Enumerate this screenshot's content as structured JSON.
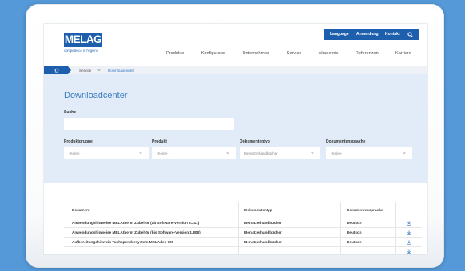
{
  "colors": {
    "background": "#5699d8",
    "brand_blue": "#1e5fad",
    "link_blue": "#3b7cc2",
    "panel_blue": "#e1ecf8"
  },
  "icons": {
    "search": "search-icon",
    "home": "home-icon",
    "breadcrumb_separator": "chevron-down-icon",
    "select_arrow": "chevron-down-icon",
    "download": "download-icon"
  },
  "utility_nav": {
    "items": [
      "Language",
      "Anmeldung",
      "Kontakt"
    ]
  },
  "logo": {
    "wordmark": "MELAG",
    "tagline": "competence in hygiene"
  },
  "main_nav": {
    "items": [
      "Produkte",
      "Konfigurator",
      "Unternehmen",
      "Service",
      "Akademie",
      "Referenzen",
      "Karriere"
    ]
  },
  "breadcrumb": {
    "items": [
      "Service",
      "Downloadcenter"
    ]
  },
  "page": {
    "title": "Downloadcenter"
  },
  "search": {
    "label": "Suche",
    "value": ""
  },
  "filters": [
    {
      "label": "Produktgruppe",
      "selected": "-Keine-"
    },
    {
      "label": "Produkt",
      "selected": "-Keine-"
    },
    {
      "label": "Dokumententyp",
      "selected": "Benutzerhandbücher"
    },
    {
      "label": "Dokumentensprache",
      "selected": "-Keine-"
    }
  ],
  "table": {
    "columns": [
      "Dokument",
      "Dokumententyp",
      "Dokumentensprache"
    ],
    "rows": [
      {
        "document": "Anwendungshinweise MELAtherm Zubehör (ab Software-Version 3.311)",
        "type": "Benutzerhandbücher",
        "language": "Deutsch"
      },
      {
        "document": "Anwendungshinweise MELAtherm Zubehör (bis Software-Version 1.808)",
        "type": "Benutzerhandbücher",
        "language": "Deutsch"
      },
      {
        "document": "Aufbereitungshinweis Tuchspendersystem MELAdes 700",
        "type": "Benutzerhandbücher",
        "language": "Deutsch"
      }
    ]
  }
}
